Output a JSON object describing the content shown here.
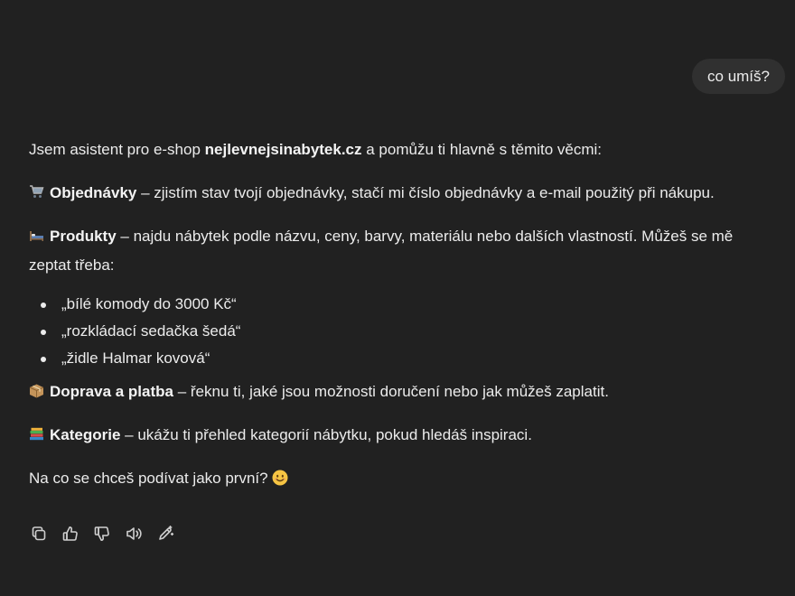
{
  "user_message": "co umíš?",
  "assistant": {
    "intro_before": "Jsem asistent pro e-shop ",
    "intro_site": "nejlevnejsinabytek.cz",
    "intro_after": " a pomůžu ti hlavně s těmito věcmi:",
    "sections": [
      {
        "icon": "shopping-cart-icon",
        "title": "Objednávky",
        "text": " – zjistím stav tvojí objednávky, stačí mi číslo objednávky a e-mail použitý při nákupu."
      },
      {
        "icon": "bed-icon",
        "title": "Produkty",
        "text": " – najdu nábytek podle názvu, ceny, barvy, materiálu nebo dalších vlastností. Můžeš se mě zeptat třeba:"
      },
      {
        "icon": "package-icon",
        "title": "Doprava a platba",
        "text": " – řeknu ti, jaké jsou možnosti doručení nebo jak můžeš zaplatit."
      },
      {
        "icon": "books-icon",
        "title": "Kategorie",
        "text": " – ukážu ti přehled kategorií nábytku, pokud hledáš inspiraci."
      }
    ],
    "examples": [
      "„bílé komody do 3000 Kč“",
      "„rozkládací sedačka šedá“",
      "„židle Halmar kovová“"
    ],
    "closing": "Na co se chceš podívat jako první?"
  },
  "actions": [
    "copy-icon",
    "thumbs-up-icon",
    "thumbs-down-icon",
    "read-aloud-icon",
    "edit-icon"
  ]
}
